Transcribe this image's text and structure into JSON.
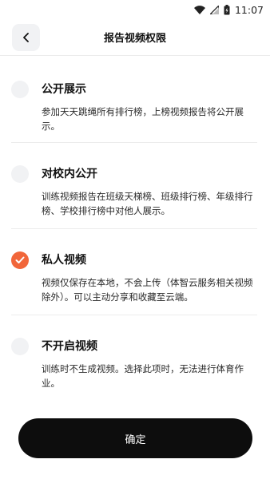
{
  "status_bar": {
    "time": "11:07"
  },
  "header": {
    "title": "报告视频权限"
  },
  "options": [
    {
      "title": "公开展示",
      "desc": "参加天天跳绳所有排行榜，上榜视频报告将公开展示。",
      "selected": false
    },
    {
      "title": "对校内公开",
      "desc": "训练视频报告在班级天梯榜、班级排行榜、年级排行榜、学校排行榜中对他人展示。",
      "selected": false
    },
    {
      "title": "私人视频",
      "desc": "视频仅保存在本地，不会上传（体智云服务相关视频除外）。可以主动分享和收藏至云端。",
      "selected": true
    },
    {
      "title": "不开启视频",
      "desc": "训练时不生成视频。选择此项时，无法进行体育作业。",
      "selected": false
    }
  ],
  "confirm_label": "确定",
  "colors": {
    "accent": "#f1663a",
    "button": "#0d0d0d"
  }
}
